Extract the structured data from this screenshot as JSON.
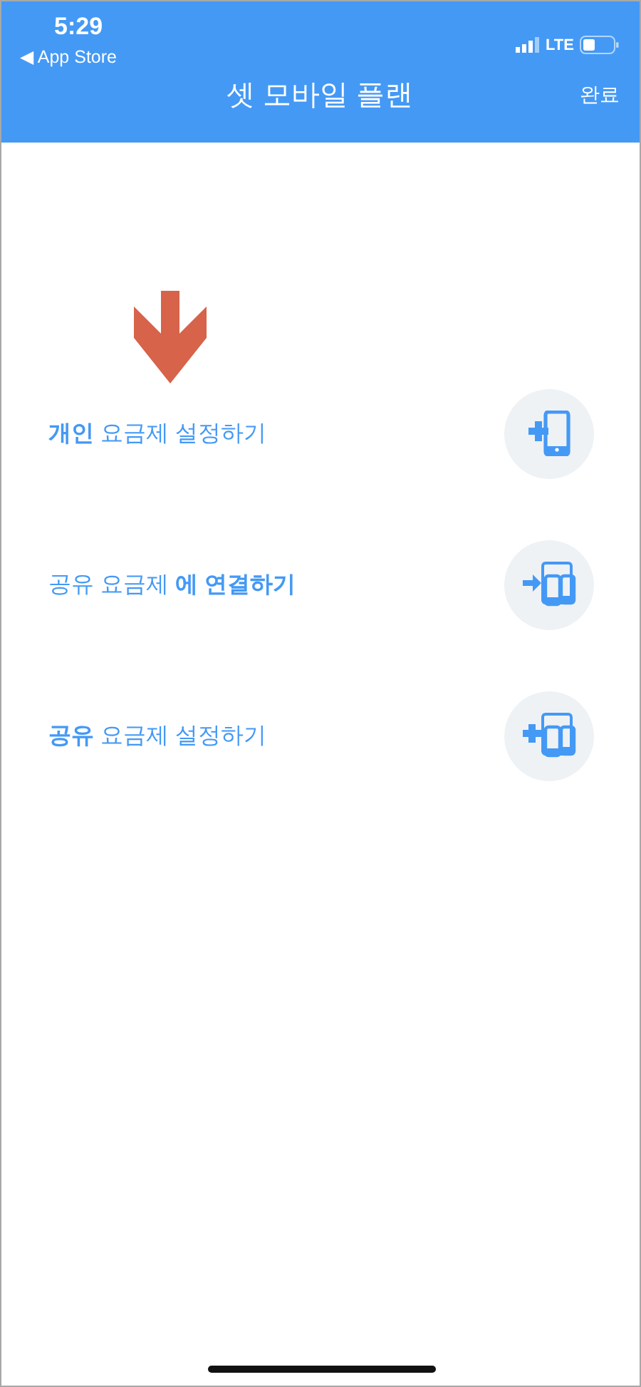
{
  "status_bar": {
    "time": "5:29",
    "back_link": "◀ App Store",
    "network": "LTE"
  },
  "nav_bar": {
    "title": "셋 모바일 플랜",
    "done": "완료"
  },
  "options": [
    {
      "label": "**개인** 요금제 설정하기",
      "kind": "add-single"
    },
    {
      "label": "공유 요금제 **에 연결하기**",
      "kind": "connect"
    },
    {
      "label": "**공유** 요금제 설정하기",
      "kind": "add-shared"
    }
  ]
}
